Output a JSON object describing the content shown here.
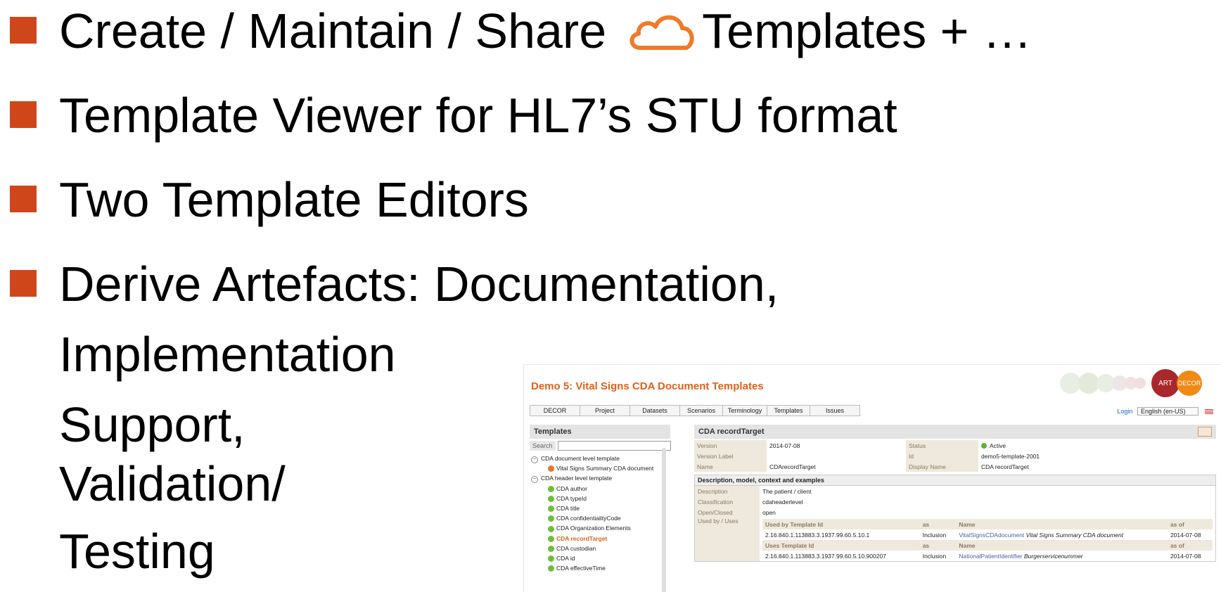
{
  "bullets": [
    {
      "before": "Create / Maintain / Share",
      "icon": "cloud-icon",
      "after": "Templates + …"
    },
    {
      "text": "Template Viewer for HL7’s STU format"
    },
    {
      "text": "Two Template Editors"
    },
    {
      "lines": [
        "Derive Artefacts: Documentation,",
        "Implementation",
        "Support,",
        "Validation/",
        "Testing"
      ]
    }
  ],
  "colors": {
    "bullet": "#d0461b",
    "cloud": "#f07a2a",
    "accent": "#e1601b",
    "art": "#a8282d",
    "decor": "#f08a14"
  },
  "app": {
    "title": "Demo 5: Vital Signs CDA Document Templates",
    "logo_art": "ART",
    "logo_decor": "DECOR",
    "nav": [
      "DECOR",
      "Project",
      "Datasets",
      "Scenarios",
      "Terminology",
      "Templates",
      "Issues"
    ],
    "login": "Login",
    "language": "English (en-US)",
    "left_title": "Templates",
    "search_label": "Search",
    "tree": [
      {
        "label": "CDA document level template",
        "level": 0,
        "kind": "group"
      },
      {
        "label": "Vital Signs Summary CDA document",
        "level": 1,
        "kind": "orange"
      },
      {
        "label": "CDA header level template",
        "level": 0,
        "kind": "group"
      },
      {
        "label": "CDA author",
        "level": 1,
        "kind": "green"
      },
      {
        "label": "CDA typeId",
        "level": 1,
        "kind": "green"
      },
      {
        "label": "CDA title",
        "level": 1,
        "kind": "green"
      },
      {
        "label": "CDA confidentialityCode",
        "level": 1,
        "kind": "green"
      },
      {
        "label": "CDA Organization Elements",
        "level": 1,
        "kind": "green"
      },
      {
        "label": "CDA recordTarget",
        "level": 1,
        "kind": "green",
        "selected": true
      },
      {
        "label": "CDA custodian",
        "level": 1,
        "kind": "green"
      },
      {
        "label": "CDA id",
        "level": 1,
        "kind": "green"
      },
      {
        "label": "CDA effectiveTime",
        "level": 1,
        "kind": "green"
      }
    ],
    "detail_title": "CDA recordTarget",
    "props": {
      "version_label": "Version",
      "version": "2014-07-08",
      "status_label": "Status",
      "status": "Active",
      "version_label_label": "Version Label",
      "version_label_value": "",
      "id_label": "Id",
      "id": "demo5-template-2001",
      "name_label": "Name",
      "name": "CDArecordTarget",
      "display_name_label": "Display Name",
      "display_name": "CDA recordTarget"
    },
    "section": {
      "title": "Description, model, context and examples",
      "description_label": "Description",
      "description": "The patient / client",
      "classification_label": "Classification",
      "classification": "cdaheaderlevel",
      "open_closed_label": "Open/Closed",
      "open_closed": "open",
      "used_by_label": "Used by / Uses",
      "used_by_header": {
        "id": "Used by Template Id",
        "as": "as",
        "name": "Name",
        "asof": "as of"
      },
      "used_by_row": {
        "id": "2.16.840.1.113883.3.1937.99.60.5.10.1",
        "as": "Inclusion",
        "link": "VitalSignsCDAdocument",
        "name": "Vital Signs Summary CDA document",
        "asof": "2014-07-08"
      },
      "uses_header": {
        "id": "Uses Template Id",
        "as": "as",
        "name": "Name",
        "asof": "as of"
      },
      "uses_row": {
        "id": "2.16.840.1.113883.3.1937.99.60.5.10.900207",
        "as": "Inclusion",
        "link": "NationalPatientIdentifier",
        "name": "Burgerservicenummer",
        "asof": "2014-07-08"
      }
    }
  }
}
